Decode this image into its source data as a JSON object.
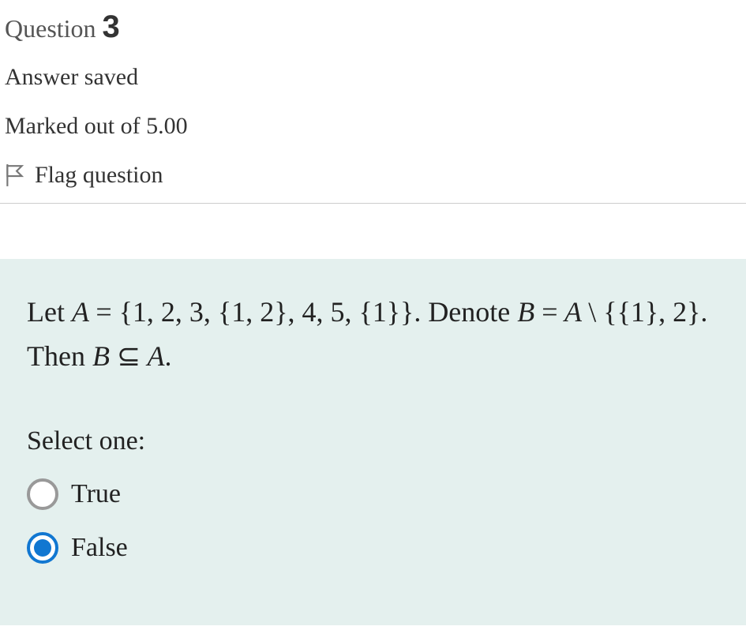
{
  "header": {
    "question_label": "Question",
    "question_number": "3",
    "status": "Answer saved",
    "marked": "Marked out of 5.00",
    "flag": "Flag question"
  },
  "question": {
    "text_prefix": "Let ",
    "math_A": "A = {1, 2, 3, {1, 2}, 4, 5, {1}}",
    "text_mid1": ". Denote ",
    "math_B": "B = A \\ {{1}, 2}",
    "text_mid2": ". Then ",
    "math_concl": "B ⊆ A",
    "text_suffix": ".",
    "prompt": "Select one:",
    "options": {
      "true": "True",
      "false": "False"
    },
    "selected": "false"
  }
}
